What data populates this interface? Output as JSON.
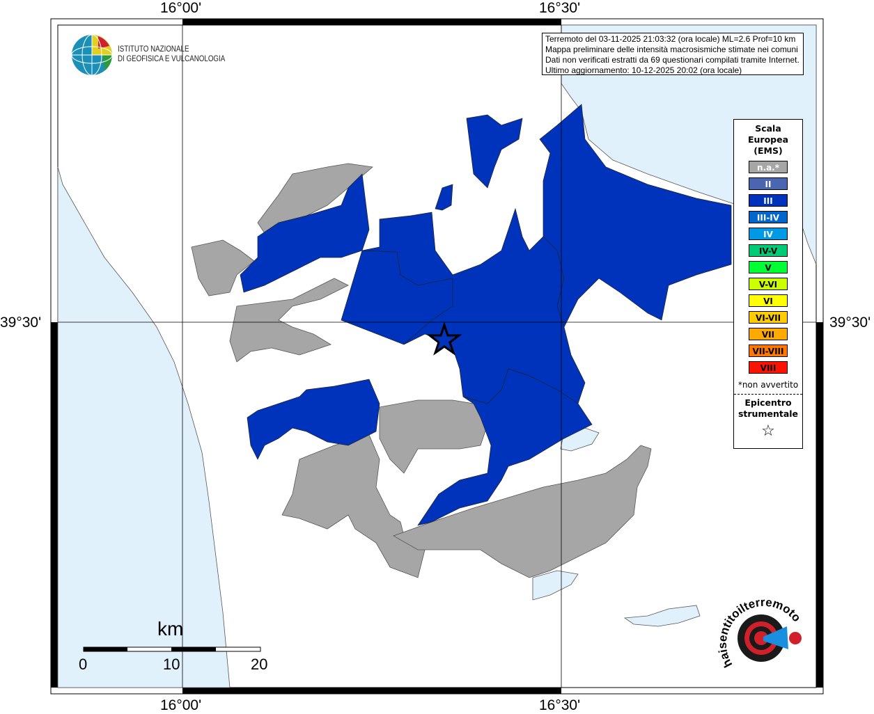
{
  "map": {
    "grid": {
      "lon_labels": [
        "16°00'",
        "16°30'"
      ],
      "lat_labels": [
        "39°30'"
      ]
    },
    "colors": {
      "sea": "#e0f1fb",
      "land": "#ffffff",
      "intensity_III": "#0033bb",
      "not_felt": "#a6a6a6"
    },
    "epicenter_icon": "star-icon"
  },
  "info": {
    "lines": [
      "Terremoto del 03-11-2025 21:03:32 (ora locale) ML=2.6 Prof=10 km",
      "Mappa preliminare delle intensità macrosismiche stimate nei comuni",
      "Dati non verificati estratti da 69 questionari compilati tramite Internet.",
      "Ultimo aggiornamento: 10-12-2025 20:02 (ora locale)"
    ]
  },
  "logo": {
    "name": "ISTITUTO NAZIONALE DI GEOFISICA E VULCANOLOGIA",
    "line1": "ISTITUTO NAZIONALE",
    "line2": "DI GEOFISICA E VULCANOLOGIA"
  },
  "legend": {
    "title": [
      "Scala",
      "Europea",
      "(EMS)"
    ],
    "items": [
      {
        "label": "n.a.*",
        "color": "#a6a6a6",
        "text": "#ffffff"
      },
      {
        "label": "II",
        "color": "#4b66b0",
        "text": "#ffffff"
      },
      {
        "label": "III",
        "color": "#0033bb",
        "text": "#ffffff"
      },
      {
        "label": "III-IV",
        "color": "#0066cc",
        "text": "#ffffff"
      },
      {
        "label": "IV",
        "color": "#0099e6",
        "text": "#ffffff"
      },
      {
        "label": "IV-V",
        "color": "#00cc77",
        "text": "#000000"
      },
      {
        "label": "V",
        "color": "#00ff33",
        "text": "#000000"
      },
      {
        "label": "V-VI",
        "color": "#ccff00",
        "text": "#000000"
      },
      {
        "label": "VI",
        "color": "#ffff00",
        "text": "#000000"
      },
      {
        "label": "VI-VII",
        "color": "#ffcc00",
        "text": "#000000"
      },
      {
        "label": "VII",
        "color": "#ffaa00",
        "text": "#000000"
      },
      {
        "label": "VII-VIII",
        "color": "#ff7700",
        "text": "#000000"
      },
      {
        "label": "VIII",
        "color": "#ff1100",
        "text": "#000000"
      }
    ],
    "note": "*non avvertito",
    "epicenter": [
      "Epicentro",
      "strumentale"
    ],
    "epicenter_symbol": "☆"
  },
  "scale": {
    "unit": "km",
    "labels": [
      "0",
      "10",
      "20"
    ]
  },
  "hsit_logo": {
    "text": "www.haisentitoilterremoto.it"
  }
}
